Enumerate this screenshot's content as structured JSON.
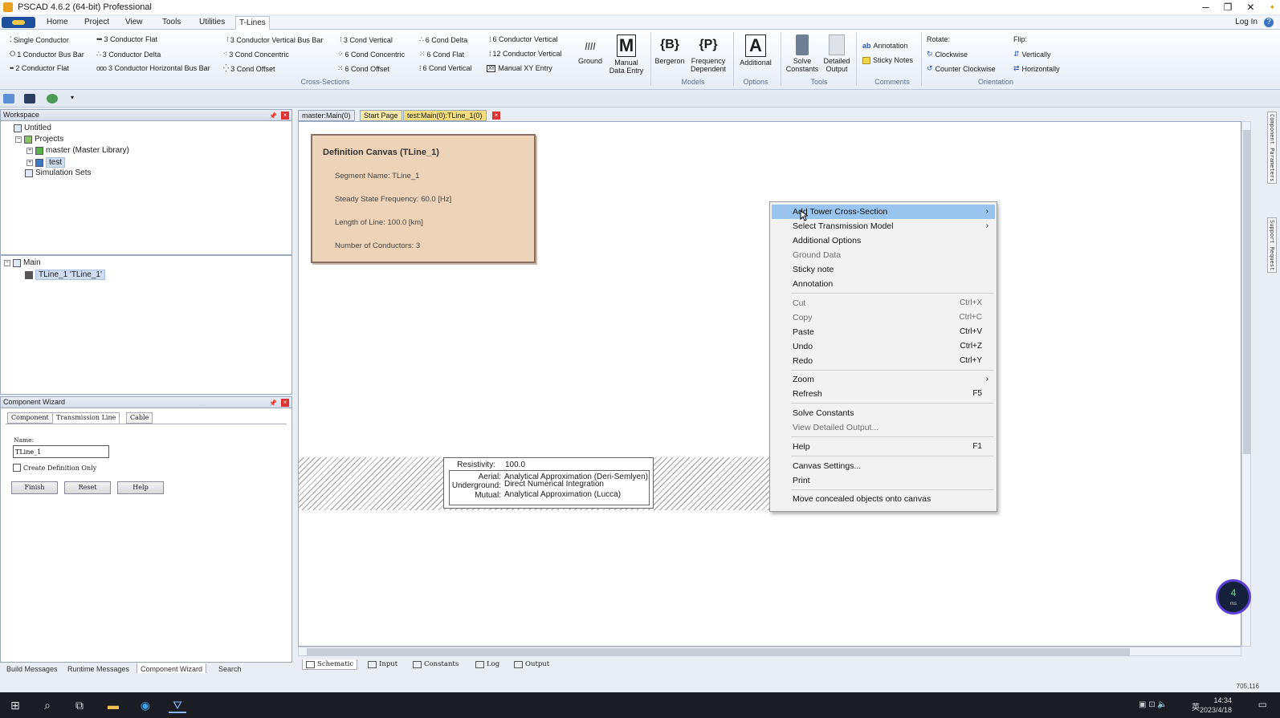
{
  "window": {
    "title": "PSCAD 4.6.2 (64-bit) Professional",
    "min": "─",
    "max": "❐",
    "close": "✕",
    "pin": "✦"
  },
  "menu": {
    "tabs": [
      "Home",
      "Project",
      "View",
      "Tools",
      "Utilities",
      "T-Lines"
    ],
    "active": "T-Lines",
    "login": "Log In",
    "help": "?"
  },
  "ribbon": {
    "cross_sections": [
      "Single Conductor",
      "1 Conductor Bus Bar",
      "2 Conductor Flat",
      "3 Conductor Flat",
      "3 Conductor Delta",
      "3 Conductor Horizontal Bus Bar",
      "3 Conductor Vertical Bus Bar",
      "3 Cond Concentric",
      "3 Cond Offset",
      "3 Cond Vertical",
      "6 Cond Concentric",
      "6 Cond Offset",
      "6 Cond Delta",
      "6 Cond Flat",
      "6 Cond Vertical",
      "6 Conductor Vertical",
      "12 Conductor Vertical",
      "Manual XY Entry"
    ],
    "ground": "Ground",
    "manual_data_entry": "Manual Data Entry",
    "bergeron": "Bergeron",
    "freq_dependent": "Frequency Dependent",
    "additional": "Additional",
    "solve_constants": "Solve Constants",
    "detailed_output": "Detailed Output",
    "annotation": "Annotation",
    "sticky_notes": "Sticky Notes",
    "rotate": "Rotate:",
    "clockwise": "Clockwise",
    "counter_clockwise": "Counter Clockwise",
    "flip": "Flip:",
    "vertically": "Vertically",
    "horizontally": "Horizontally",
    "groups": {
      "cross_sections": "Cross-Sections",
      "models": "Models",
      "options": "Options",
      "tools": "Tools",
      "comments": "Comments",
      "orientation": "Orientation"
    }
  },
  "workspace": {
    "title": "Workspace",
    "items": [
      "Untitled",
      "Projects",
      "master (Master Library)",
      "test",
      "Simulation Sets"
    ],
    "tree2": [
      "Main",
      "TLine_1 'TLine_1'"
    ]
  },
  "wizard": {
    "title": "Component Wizard",
    "tabs": [
      "Component",
      "Transmission Line",
      "Cable"
    ],
    "name_label": "Name:",
    "name_value": "TLine_1",
    "create_def_only": "Create Definition Only",
    "buttons": [
      "Finish",
      "Reset",
      "Help"
    ]
  },
  "bottom_tabs": [
    "Build Messages",
    "Runtime Messages",
    "Component Wizard",
    "Search"
  ],
  "doc_tabs": [
    "master:Main(0)",
    "Start Page",
    "test:Main(0):TLine_1(0)"
  ],
  "definition": {
    "title": "Definition Canvas (TLine_1)",
    "segment": "Segment Name: TLine_1",
    "freq": "Steady State Frequency: 60.0 [Hz]",
    "length": "Length of Line: 100.0 [km]",
    "conductors": "Number of Conductors: 3"
  },
  "ground_box": {
    "resistivity_label": "Resistivity:",
    "resistivity": "100.0",
    "aerial_label": "Aerial:",
    "aerial": "Analytical Approximation (Deri-Semlyen)",
    "underground_label": "Underground:",
    "underground": "Direct Numerical Integration",
    "mutual_label": "Mutual:",
    "mutual": "Analytical Approximation (Lucca)"
  },
  "canvas_tabs": [
    "Schematic",
    "Input",
    "Constants",
    "Log",
    "Output"
  ],
  "context_menu": [
    {
      "label": "Add Tower Cross-Section",
      "arrow": "›"
    },
    {
      "label": "Select Transmission Model",
      "arrow": "›"
    },
    {
      "label": "Additional Options"
    },
    {
      "label": "Ground Data"
    },
    {
      "label": "Sticky note"
    },
    {
      "label": "Annotation"
    },
    {
      "label": "Cut",
      "shortcut": "Ctrl+X"
    },
    {
      "label": "Copy",
      "shortcut": "Ctrl+C"
    },
    {
      "label": "Paste",
      "shortcut": "Ctrl+V"
    },
    {
      "label": "Undo",
      "shortcut": "Ctrl+Z"
    },
    {
      "label": "Redo",
      "shortcut": "Ctrl+Y"
    },
    {
      "label": "Zoom",
      "arrow": "›"
    },
    {
      "label": "Refresh",
      "shortcut": "F5"
    },
    {
      "label": "Solve Constants"
    },
    {
      "label": "View Detailed Output..."
    },
    {
      "label": "Help",
      "shortcut": "F1"
    },
    {
      "label": "Canvas Settings..."
    },
    {
      "label": "Print"
    },
    {
      "label": "Move concealed objects onto canvas"
    }
  ],
  "rail": {
    "top": "Component Parameters",
    "bottom": "Support Request"
  },
  "badge": {
    "value": "4",
    "unit": "ms"
  },
  "status": {
    "coords": "705,116"
  },
  "taskbar": {
    "time": "14:34",
    "date": "2023/4/18",
    "ime": "英"
  }
}
